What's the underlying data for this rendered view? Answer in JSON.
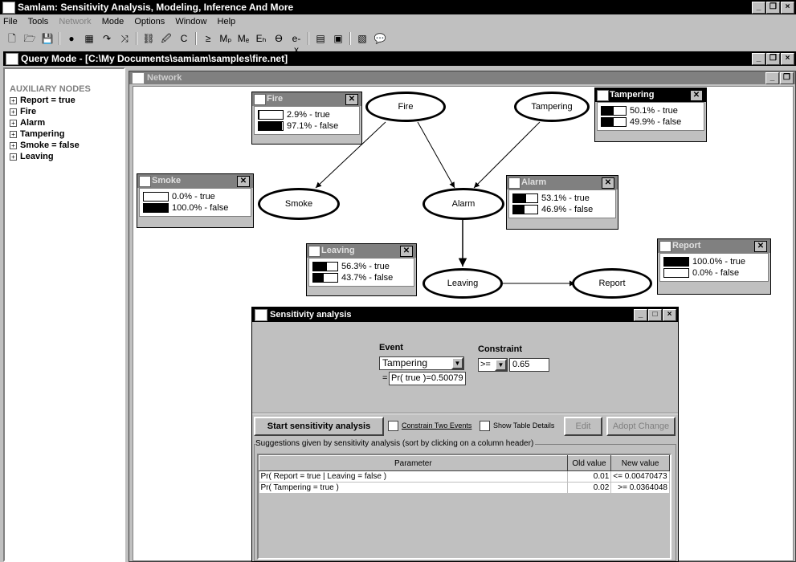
{
  "app": {
    "title": "Samlam: Sensitivity Analysis, Modeling, Inference And More"
  },
  "menu": [
    "File",
    "Tools",
    "Network",
    "Mode",
    "Options",
    "Window",
    "Help"
  ],
  "toolbar_icons": [
    "new-file-icon",
    "open-folder-icon",
    "save-icon",
    "record-icon",
    "grid-icon",
    "edge-icon",
    "delete-edge-icon",
    "network-icon",
    "edit-icon",
    "cursor-c-icon",
    "ge-icon",
    "mpe-icon",
    "mpe-e-icon",
    "eh-icon",
    "theta-icon",
    "ex-icon",
    "monitor-icon",
    "monitor2-icon",
    "calc-icon",
    "speech-icon"
  ],
  "toolbar_glyphs": [
    "🗋",
    "🗁",
    "💾",
    "●",
    "▦",
    "↷",
    "⤨",
    "⛓",
    "🖉",
    "C",
    "≥",
    "Mₚ",
    "Mₑ",
    "Eₕ",
    "ϴ",
    "e-x",
    "▤",
    "▣",
    "▧",
    "💬"
  ],
  "query": {
    "title": "Query Mode - [C:\\My Documents\\samiam\\samples\\fire.net]"
  },
  "sidebar": {
    "header": "AUXILIARY NODES",
    "items": [
      {
        "label": "Report = true"
      },
      {
        "label": "Fire"
      },
      {
        "label": "Alarm"
      },
      {
        "label": "Tampering"
      },
      {
        "label": "Smoke = false"
      },
      {
        "label": "Leaving"
      }
    ]
  },
  "network": {
    "title": "Network"
  },
  "nodes": {
    "fire": "Fire",
    "tampering": "Tampering",
    "smoke": "Smoke",
    "alarm": "Alarm",
    "leaving": "Leaving",
    "report": "Report"
  },
  "monitors": {
    "fire": {
      "title": "Fire",
      "rows": [
        {
          "label": "2.9% - true",
          "value": 0.029
        },
        {
          "label": "97.1% - false",
          "value": 0.971
        }
      ]
    },
    "tampering": {
      "title": "Tampering",
      "rows": [
        {
          "label": "50.1% - true",
          "value": 0.501
        },
        {
          "label": "49.9% - false",
          "value": 0.499
        }
      ]
    },
    "smoke": {
      "title": "Smoke",
      "rows": [
        {
          "label": "0.0% - true",
          "value": 0.0
        },
        {
          "label": "100.0% - false",
          "value": 1.0
        }
      ]
    },
    "alarm": {
      "title": "Alarm",
      "rows": [
        {
          "label": "53.1% - true",
          "value": 0.531
        },
        {
          "label": "46.9% - false",
          "value": 0.469
        }
      ]
    },
    "leaving": {
      "title": "Leaving",
      "rows": [
        {
          "label": "56.3% - true",
          "value": 0.563
        },
        {
          "label": "43.7% - false",
          "value": 0.437
        }
      ]
    },
    "report": {
      "title": "Report",
      "rows": [
        {
          "label": "100.0% - true",
          "value": 1.0
        },
        {
          "label": "0.0% - false",
          "value": 0.0
        }
      ]
    }
  },
  "sensitivity": {
    "title": "Sensitivity analysis",
    "event_label": "Event",
    "event_value": "Tampering",
    "constraint_label": "Constraint",
    "operator": ">=",
    "threshold": "0.65",
    "prob_prefix": "=",
    "prob_value": "Pr( true )=0.50079",
    "start_btn": "Start sensitivity analysis",
    "constrain_two": "Constrain Two Events",
    "show_table": "Show Table Details",
    "edit_btn": "Edit",
    "adopt_btn": "Adopt Change",
    "suggestions_label": "Suggestions given by sensitivity analysis (sort by clicking on a column header)",
    "columns": [
      "Parameter",
      "Old value",
      "New value"
    ],
    "rows": [
      {
        "param": "Pr( Report = true | Leaving = false )",
        "old": "0.01",
        "new": "<= 0.00470473"
      },
      {
        "param": "Pr( Tampering = true )",
        "old": "0.02",
        "new": ">= 0.0364048"
      }
    ]
  }
}
